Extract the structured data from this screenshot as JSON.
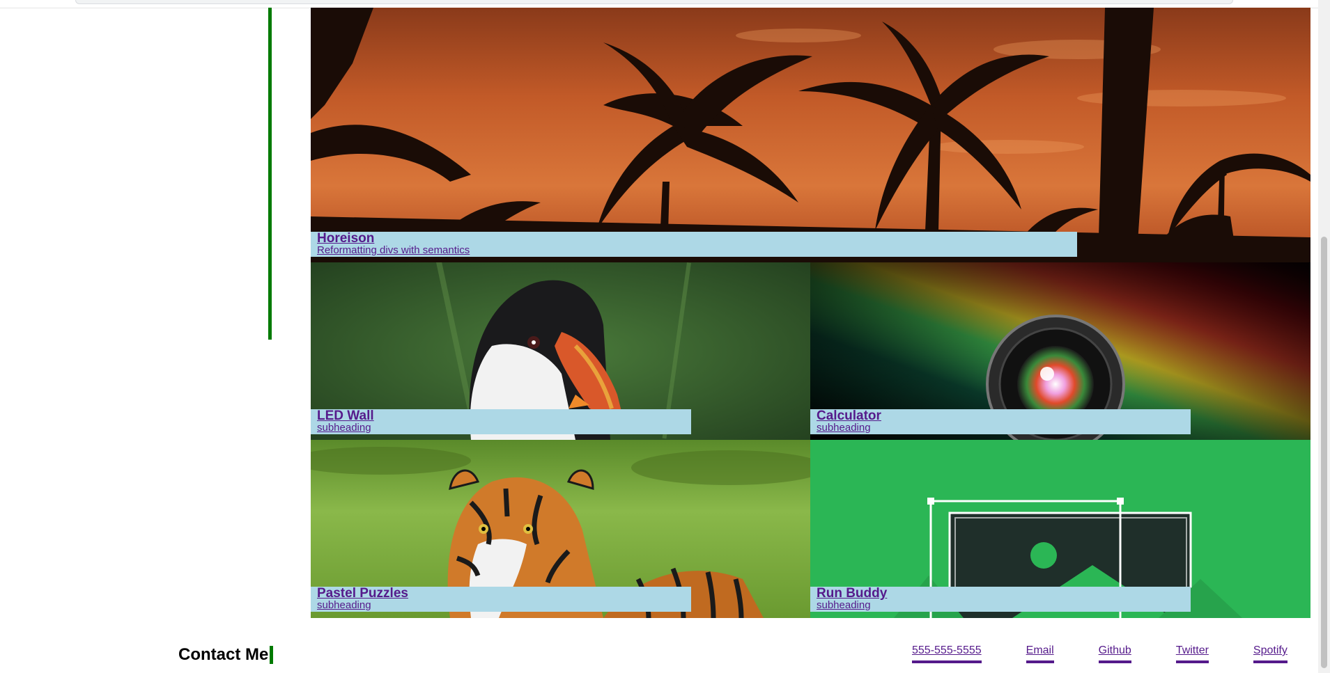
{
  "projects": [
    {
      "title": "Horeison",
      "subheading": "Reformatting divs with semantics",
      "image": "palm-trees-sunset"
    },
    {
      "title": "LED Wall",
      "subheading": "subheading",
      "image": "puffin"
    },
    {
      "title": "Calculator",
      "subheading": "subheading",
      "image": "camera-lens-rainbow"
    },
    {
      "title": "Pastel Puzzles",
      "subheading": "subheading",
      "image": "tiger"
    },
    {
      "title": "Run Buddy",
      "subheading": "subheading",
      "image": "image-placeholder-green"
    }
  ],
  "contact": {
    "title": "Contact Me",
    "links": [
      "555-555-5555",
      "Email",
      "Github",
      "Twitter",
      "Spotify"
    ]
  },
  "colors": {
    "accent_green": "#007a00",
    "caption_bg": "#add8e6",
    "link_visited": "#551a8b",
    "run_buddy_green": "#2bb655"
  }
}
